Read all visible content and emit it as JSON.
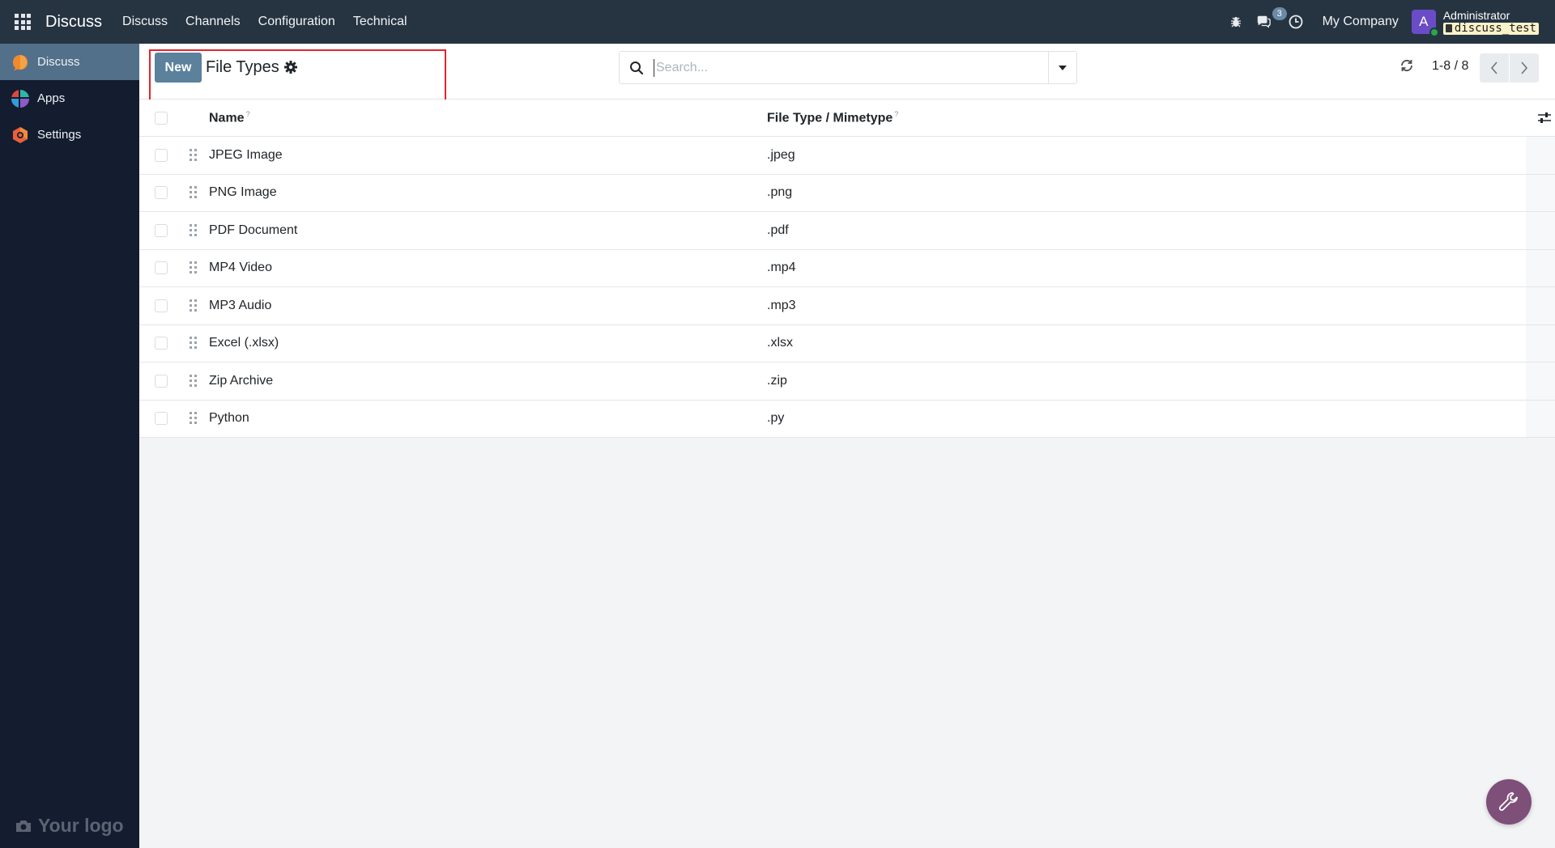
{
  "navbar": {
    "brand": "Discuss",
    "menu": [
      "Discuss",
      "Channels",
      "Configuration",
      "Technical"
    ],
    "chat_count": "3",
    "company": "My Company",
    "avatar_letter": "A",
    "user_name": "Administrator",
    "db_name": "discuss_test"
  },
  "sidebar": {
    "items": [
      {
        "label": "Discuss",
        "icon": "discuss-icon",
        "active": true
      },
      {
        "label": "Apps",
        "icon": "apps-icon",
        "active": false
      },
      {
        "label": "Settings",
        "icon": "settings-icon",
        "active": false
      }
    ],
    "logo_text": "Your logo"
  },
  "control": {
    "new_label": "New",
    "title": "File Types",
    "search_placeholder": "Search...",
    "pager": "1-8 / 8"
  },
  "table": {
    "columns": [
      "Name",
      "File Type / Mimetype"
    ],
    "rows": [
      {
        "name": "JPEG Image",
        "type": ".jpeg"
      },
      {
        "name": "PNG Image",
        "type": ".png"
      },
      {
        "name": "PDF Document",
        "type": ".pdf"
      },
      {
        "name": "MP4 Video",
        "type": ".mp4"
      },
      {
        "name": "MP3 Audio",
        "type": ".mp3"
      },
      {
        "name": "Excel (.xlsx)",
        "type": ".xlsx"
      },
      {
        "name": "Zip Archive",
        "type": ".zip"
      },
      {
        "name": "Python",
        "type": ".py"
      }
    ]
  },
  "colors": {
    "navbar": "#263442",
    "sidebar": "#131d2f",
    "sidebar_active": "#53708a",
    "primary_button": "#5b819c",
    "highlight": "#e4232d",
    "fab": "#7e4f78"
  }
}
